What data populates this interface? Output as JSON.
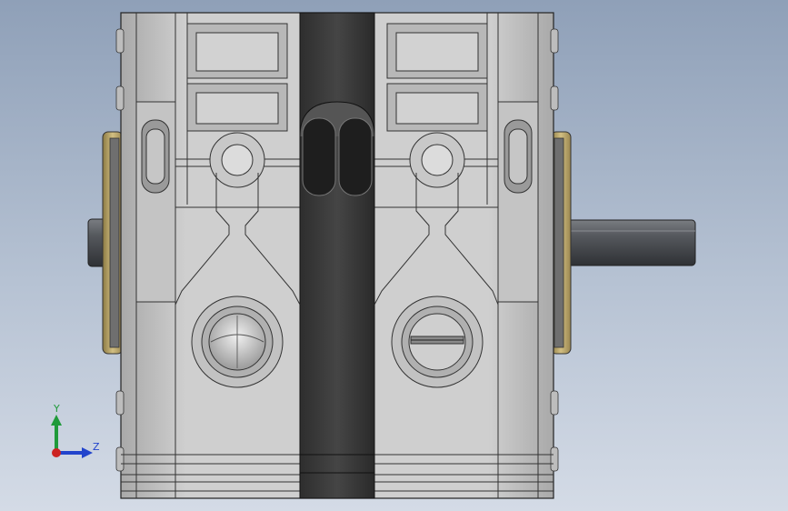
{
  "viewport": {
    "background_top": "#8fa0b8",
    "background_bottom": "#d4dbe6"
  },
  "model": {
    "body_color": "#c9c9c9",
    "band_color": "#3d3d3d",
    "flange_color": "#b8a46a",
    "shaft_color": "#5a5d62"
  },
  "triad": {
    "y_label": "Y",
    "z_label": "Z",
    "y_color": "#1f9a3a",
    "z_color": "#2244cc",
    "x_color": "#cc2222"
  }
}
